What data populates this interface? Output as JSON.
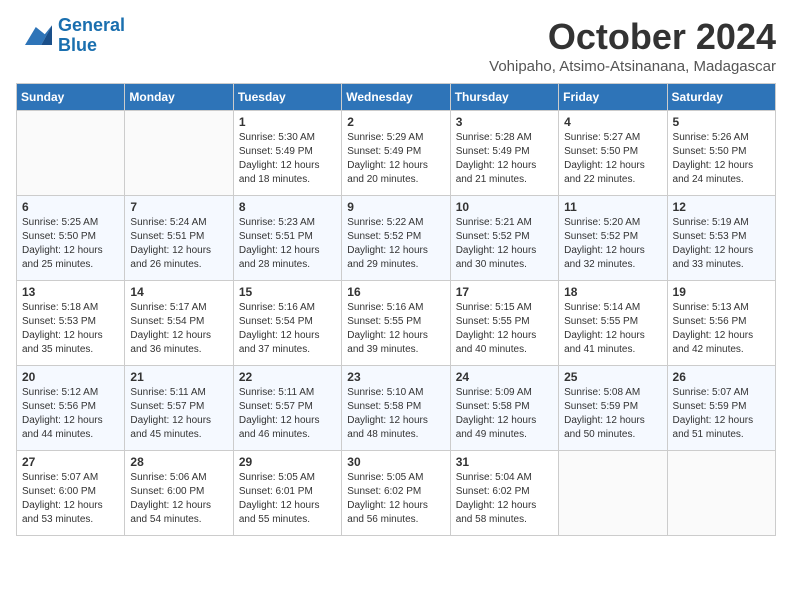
{
  "logo": {
    "line1": "General",
    "line2": "Blue"
  },
  "title": "October 2024",
  "location": "Vohipaho, Atsimo-Atsinanana, Madagascar",
  "days_of_week": [
    "Sunday",
    "Monday",
    "Tuesday",
    "Wednesday",
    "Thursday",
    "Friday",
    "Saturday"
  ],
  "weeks": [
    [
      {
        "day": "",
        "info": ""
      },
      {
        "day": "",
        "info": ""
      },
      {
        "day": "1",
        "info": "Sunrise: 5:30 AM\nSunset: 5:49 PM\nDaylight: 12 hours and 18 minutes."
      },
      {
        "day": "2",
        "info": "Sunrise: 5:29 AM\nSunset: 5:49 PM\nDaylight: 12 hours and 20 minutes."
      },
      {
        "day": "3",
        "info": "Sunrise: 5:28 AM\nSunset: 5:49 PM\nDaylight: 12 hours and 21 minutes."
      },
      {
        "day": "4",
        "info": "Sunrise: 5:27 AM\nSunset: 5:50 PM\nDaylight: 12 hours and 22 minutes."
      },
      {
        "day": "5",
        "info": "Sunrise: 5:26 AM\nSunset: 5:50 PM\nDaylight: 12 hours and 24 minutes."
      }
    ],
    [
      {
        "day": "6",
        "info": "Sunrise: 5:25 AM\nSunset: 5:50 PM\nDaylight: 12 hours and 25 minutes."
      },
      {
        "day": "7",
        "info": "Sunrise: 5:24 AM\nSunset: 5:51 PM\nDaylight: 12 hours and 26 minutes."
      },
      {
        "day": "8",
        "info": "Sunrise: 5:23 AM\nSunset: 5:51 PM\nDaylight: 12 hours and 28 minutes."
      },
      {
        "day": "9",
        "info": "Sunrise: 5:22 AM\nSunset: 5:52 PM\nDaylight: 12 hours and 29 minutes."
      },
      {
        "day": "10",
        "info": "Sunrise: 5:21 AM\nSunset: 5:52 PM\nDaylight: 12 hours and 30 minutes."
      },
      {
        "day": "11",
        "info": "Sunrise: 5:20 AM\nSunset: 5:52 PM\nDaylight: 12 hours and 32 minutes."
      },
      {
        "day": "12",
        "info": "Sunrise: 5:19 AM\nSunset: 5:53 PM\nDaylight: 12 hours and 33 minutes."
      }
    ],
    [
      {
        "day": "13",
        "info": "Sunrise: 5:18 AM\nSunset: 5:53 PM\nDaylight: 12 hours and 35 minutes."
      },
      {
        "day": "14",
        "info": "Sunrise: 5:17 AM\nSunset: 5:54 PM\nDaylight: 12 hours and 36 minutes."
      },
      {
        "day": "15",
        "info": "Sunrise: 5:16 AM\nSunset: 5:54 PM\nDaylight: 12 hours and 37 minutes."
      },
      {
        "day": "16",
        "info": "Sunrise: 5:16 AM\nSunset: 5:55 PM\nDaylight: 12 hours and 39 minutes."
      },
      {
        "day": "17",
        "info": "Sunrise: 5:15 AM\nSunset: 5:55 PM\nDaylight: 12 hours and 40 minutes."
      },
      {
        "day": "18",
        "info": "Sunrise: 5:14 AM\nSunset: 5:55 PM\nDaylight: 12 hours and 41 minutes."
      },
      {
        "day": "19",
        "info": "Sunrise: 5:13 AM\nSunset: 5:56 PM\nDaylight: 12 hours and 42 minutes."
      }
    ],
    [
      {
        "day": "20",
        "info": "Sunrise: 5:12 AM\nSunset: 5:56 PM\nDaylight: 12 hours and 44 minutes."
      },
      {
        "day": "21",
        "info": "Sunrise: 5:11 AM\nSunset: 5:57 PM\nDaylight: 12 hours and 45 minutes."
      },
      {
        "day": "22",
        "info": "Sunrise: 5:11 AM\nSunset: 5:57 PM\nDaylight: 12 hours and 46 minutes."
      },
      {
        "day": "23",
        "info": "Sunrise: 5:10 AM\nSunset: 5:58 PM\nDaylight: 12 hours and 48 minutes."
      },
      {
        "day": "24",
        "info": "Sunrise: 5:09 AM\nSunset: 5:58 PM\nDaylight: 12 hours and 49 minutes."
      },
      {
        "day": "25",
        "info": "Sunrise: 5:08 AM\nSunset: 5:59 PM\nDaylight: 12 hours and 50 minutes."
      },
      {
        "day": "26",
        "info": "Sunrise: 5:07 AM\nSunset: 5:59 PM\nDaylight: 12 hours and 51 minutes."
      }
    ],
    [
      {
        "day": "27",
        "info": "Sunrise: 5:07 AM\nSunset: 6:00 PM\nDaylight: 12 hours and 53 minutes."
      },
      {
        "day": "28",
        "info": "Sunrise: 5:06 AM\nSunset: 6:00 PM\nDaylight: 12 hours and 54 minutes."
      },
      {
        "day": "29",
        "info": "Sunrise: 5:05 AM\nSunset: 6:01 PM\nDaylight: 12 hours and 55 minutes."
      },
      {
        "day": "30",
        "info": "Sunrise: 5:05 AM\nSunset: 6:02 PM\nDaylight: 12 hours and 56 minutes."
      },
      {
        "day": "31",
        "info": "Sunrise: 5:04 AM\nSunset: 6:02 PM\nDaylight: 12 hours and 58 minutes."
      },
      {
        "day": "",
        "info": ""
      },
      {
        "day": "",
        "info": ""
      }
    ]
  ]
}
